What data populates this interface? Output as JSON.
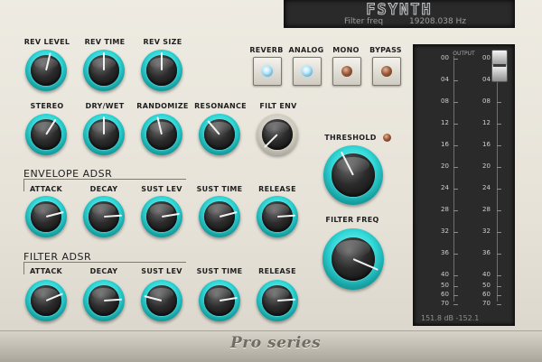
{
  "display": {
    "title": "FSYNTH",
    "param_name": "Filter freq",
    "param_value": "19208.038 Hz"
  },
  "knobs": {
    "rev_level": {
      "label": "REV  LEVEL",
      "value": 0.55
    },
    "rev_time": {
      "label": "REV  TIME",
      "value": 0.5
    },
    "rev_size": {
      "label": "REV  SIZE",
      "value": 0.5
    },
    "stereo": {
      "label": "STEREO",
      "value": 0.62
    },
    "dry_wet": {
      "label": "DRY/WET",
      "value": 0.5
    },
    "randomize": {
      "label": "RANDOMIZE",
      "value": 0.45
    },
    "resonance": {
      "label": "RESONANCE",
      "value": 0.35
    },
    "filt_env": {
      "label": "FILT  ENV",
      "value": 0.0
    },
    "threshold": {
      "label": "THRESHOLD",
      "value": 0.4
    },
    "filter_freq": {
      "label": "FILTER  FREQ",
      "value": 0.92
    }
  },
  "envelope_adsr": {
    "title": "ENVELOPE  ADSR",
    "knobs": [
      {
        "label": "ATTACK",
        "value": 0.78
      },
      {
        "label": "DECAY",
        "value": 0.82
      },
      {
        "label": "SUST  LEV",
        "value": 0.8
      },
      {
        "label": "SUST  TIME",
        "value": 0.78
      },
      {
        "label": "RELEASE",
        "value": 0.82
      }
    ]
  },
  "filter_adsr": {
    "title": "FILTER  ADSR",
    "knobs": [
      {
        "label": "ATTACK",
        "value": 0.75
      },
      {
        "label": "DECAY",
        "value": 0.82
      },
      {
        "label": "SUST  LEV",
        "value": 0.22
      },
      {
        "label": "SUST  TIME",
        "value": 0.8
      },
      {
        "label": "RELEASE",
        "value": 0.82
      }
    ]
  },
  "switches": [
    {
      "label": "REVERB",
      "led": "blue"
    },
    {
      "label": "ANALOG",
      "led": "blue"
    },
    {
      "label": "MONO",
      "led": "brown"
    },
    {
      "label": "BYPASS",
      "led": "brown"
    }
  ],
  "meter": {
    "label": "OUTPUT",
    "left_ticks": [
      "00",
      "04",
      "08",
      "12",
      "16",
      "20",
      "24",
      "28",
      "32",
      "36",
      "40",
      "50",
      "60",
      "70"
    ],
    "right_ticks": [
      "00",
      "04",
      "08",
      "12",
      "16",
      "20",
      "24",
      "28",
      "32",
      "36",
      "40",
      "50",
      "60",
      "70"
    ],
    "readout": "151.8 dB -152.1",
    "fader_value": 1.0
  },
  "footer": {
    "brand": "Pro series"
  },
  "colors": {
    "knob_ring_active": "#33d9d9",
    "knob_cap": "#1a1a1a",
    "panel": "#e8e5dc",
    "display_bg": "#2a2a2a"
  }
}
